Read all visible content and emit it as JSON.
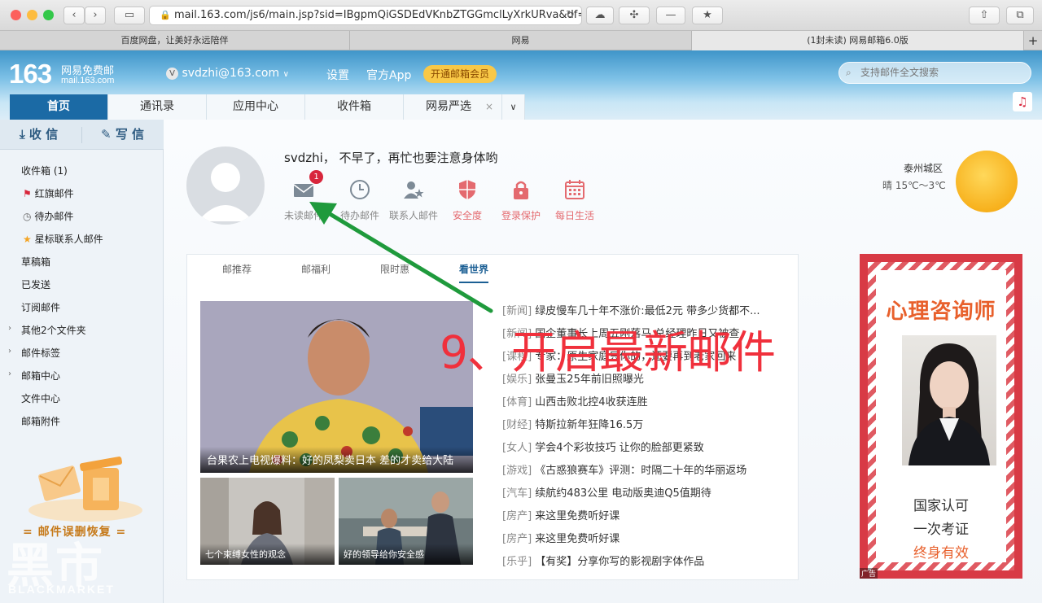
{
  "browser": {
    "url": "mail.163.com/js6/main.jsp?sid=IBgpmQiGSDEdVKnbZTGGmclLyXrkURva&df=1",
    "tabs": [
      "百度网盘，让美好永远陪伴",
      "网易",
      "(1封未读) 网易邮箱6.0版"
    ],
    "new_tab": "+"
  },
  "header": {
    "logo_number": "163",
    "logo_name": "网易免费邮",
    "logo_domain": "mail.163.com",
    "account": "svdzhi@163.com",
    "links": [
      "设置",
      "官方App"
    ],
    "vip": "开通邮箱会员",
    "search_placeholder": "支持邮件全文搜索"
  },
  "nav_tabs": [
    "首页",
    "通讯录",
    "应用中心",
    "收件箱",
    "网易严选"
  ],
  "sidebar": {
    "receive": "收 信",
    "write": "写 信",
    "folders": [
      "收件箱 (1)",
      "红旗邮件",
      "待办邮件",
      "星标联系人邮件",
      "草稿箱",
      "已发送",
      "订阅邮件",
      "其他2个文件夹",
      "邮件标签",
      "邮箱中心",
      "文件中心",
      "邮箱附件"
    ],
    "recover": "= 邮件误删恢复 ="
  },
  "home": {
    "greeting": "svdzhi，  不早了，再忙也要注意身体哟",
    "quick": [
      "未读邮件",
      "待办邮件",
      "联系人邮件",
      "安全度",
      "登录保护",
      "每日生活"
    ],
    "unread_badge": "1"
  },
  "weather": {
    "city": "泰州城区",
    "desc": "晴 15℃～3℃"
  },
  "news": {
    "tabs": [
      "邮推荐",
      "邮福利",
      "限时惠",
      "看世界"
    ],
    "big_caption": "台果农上电视爆料：好的凤梨卖日本 差的才卖给大陆",
    "small_captions": [
      "七个束缚女性的观念",
      "好的领导给你安全感"
    ],
    "items": [
      {
        "cat": "[新闻]",
        "title": "绿皮慢车几十年不涨价:最低2元 带多少货都不..."
      },
      {
        "cat": "[新闻]",
        "title": "国企董事长上周五刚落马 总经理昨日又被查"
      },
      {
        "cat": "[课程]",
        "title": "专家：原生家庭只你的，还要再到老家回来"
      },
      {
        "cat": "[娱乐]",
        "title": "张曼玉25年前旧照曝光"
      },
      {
        "cat": "[体育]",
        "title": "山西击败北控4收获连胜"
      },
      {
        "cat": "[财经]",
        "title": "特斯拉新年狂降16.5万"
      },
      {
        "cat": "[女人]",
        "title": "学会4个彩妆技巧 让你的脸部更紧致"
      },
      {
        "cat": "[游戏]",
        "title": "《古惑狼赛车》评测：时隔二十年的华丽返场"
      },
      {
        "cat": "[汽车]",
        "title": "续航约483公里 电动版奥迪Q5值期待"
      },
      {
        "cat": "[房产]",
        "title": "来这里免费听好课"
      },
      {
        "cat": "[房产]",
        "title": "来这里免费听好课"
      },
      {
        "cat": "[乐乎]",
        "title": "【有奖】分享你写的影视剧字体作品"
      }
    ]
  },
  "ad": {
    "title": "心理咨询师",
    "line1": "国家认可",
    "line2": "一次考证",
    "line3": "终身有效",
    "tag": "广告"
  },
  "annotation": "9、开启最新邮件",
  "watermark": {
    "cn": "黑市",
    "en": "BLACKMARKET"
  },
  "colors": {
    "brand_blue": "#1b6aa5",
    "annotation_red": "#f0303c",
    "arrow_green": "#1f9a3c"
  }
}
